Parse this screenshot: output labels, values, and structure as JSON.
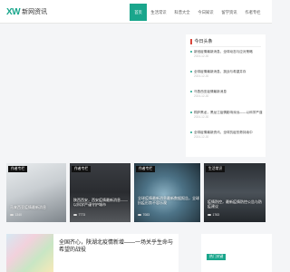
{
  "brand": {
    "mark": "XW",
    "name": "新网资讯",
    "accent": "#1aa68c"
  },
  "nav": [
    {
      "label": "首页",
      "active": true
    },
    {
      "label": "生活常识",
      "active": false
    },
    {
      "label": "科普大全",
      "active": false
    },
    {
      "label": "今日知识",
      "active": false
    },
    {
      "label": "留学资讯",
      "active": false
    },
    {
      "label": "作者专栏",
      "active": false
    }
  ],
  "today_panel": {
    "title": "今日头条",
    "items": [
      {
        "title": "新冠疫情最新消息，全球动态与应对策略",
        "date": "2024-12-30"
      },
      {
        "title": "全球疫情最新消息，挑战与希望并存",
        "date": "2024-12-30"
      },
      {
        "title": "乌鲁西亚疫情最新消息",
        "date": "2024-12-30"
      },
      {
        "title": "桐庐黑龙，黑龙江疫情影响深远——以科学严谨",
        "date": "2024-12-30"
      },
      {
        "title": "全球疫情最新资讯，全球抗疫形势持续中",
        "date": "2024-12-30"
      }
    ]
  },
  "cards": [
    {
      "tag": "作者专栏",
      "title": "马来西亚疫情最新消息",
      "views": "1340"
    },
    {
      "tag": "作者专栏",
      "title": "陕西西安，西安疫情最新消息——以科学严谨守护城市",
      "views": "7773"
    },
    {
      "tag": "作者专栏",
      "title": "全球疫情最新消息最新数据报告，全球抗疫形势不容乐观",
      "views": "7083"
    },
    {
      "tag": "生活常识",
      "title": "疫情防控，最新疫情防控公告与防疫建议",
      "views": "1763"
    }
  ],
  "feature": {
    "title": "全国齐心，陕湖北疫情新增——一场关乎生命与希望的战役"
  },
  "tags_panel": {
    "button": "热门关键"
  }
}
